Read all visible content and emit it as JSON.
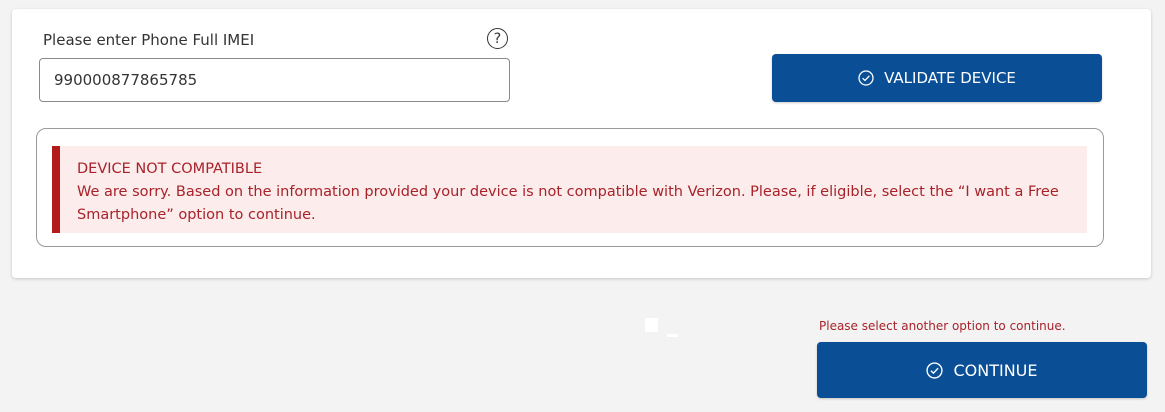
{
  "form": {
    "imei_label": "Please enter Phone Full IMEI",
    "imei_value": "990000877865785",
    "help_icon": "question-mark-icon",
    "validate_label": "VALIDATE DEVICE"
  },
  "alert": {
    "title": "DEVICE NOT COMPATIBLE",
    "message": "We are sorry. Based on the information provided your device is not compatible with Verizon. Please, if eligible, select the “I want a Free Smartphone” option to continue.",
    "color": "#a8222a",
    "bar_color": "#b31b1b",
    "background": "#fcecec"
  },
  "footer": {
    "hint": "Please select another option to continue.",
    "continue_label": "CONTINUE"
  },
  "colors": {
    "primary_button": "#0a4e96",
    "page_background": "#f3f3f3"
  }
}
